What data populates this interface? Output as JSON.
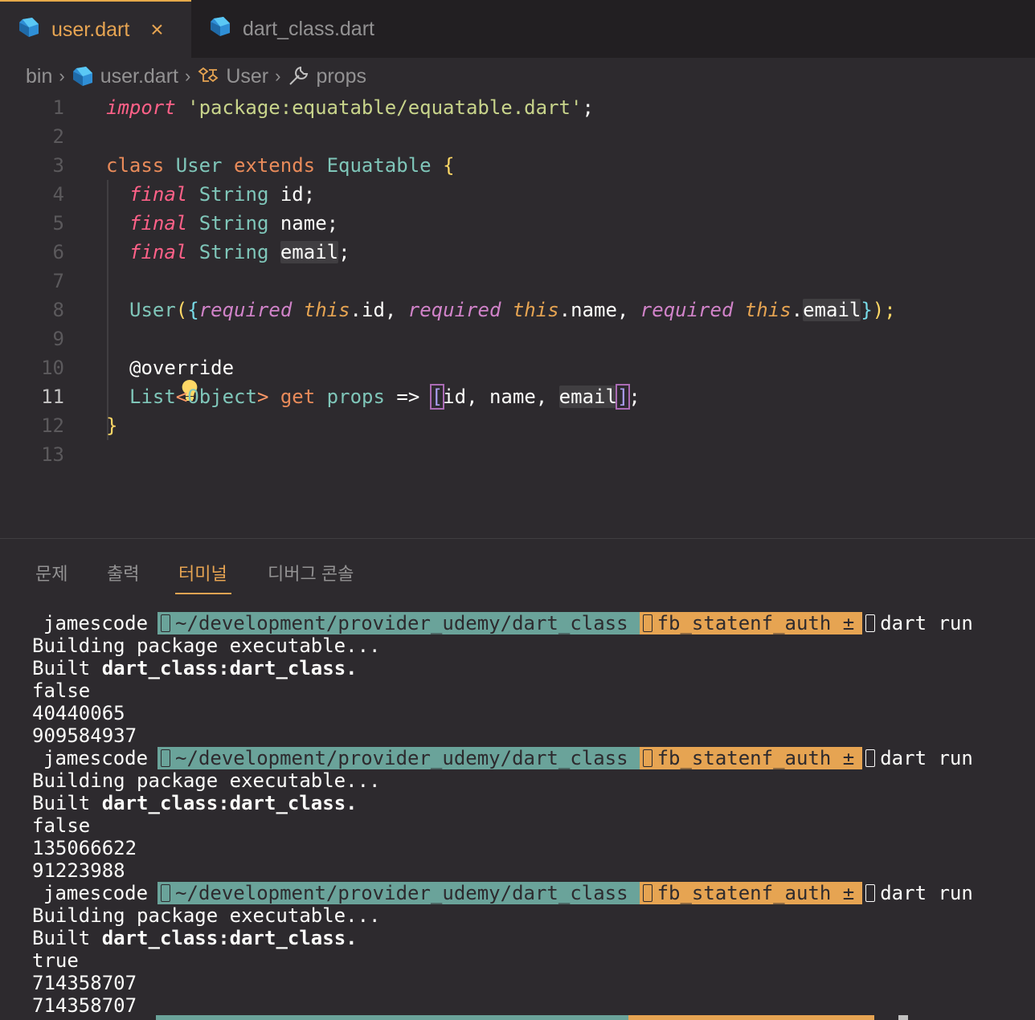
{
  "tabs": [
    {
      "label": "user.dart",
      "active": true,
      "close": "×"
    },
    {
      "label": "dart_class.dart",
      "active": false
    }
  ],
  "breadcrumb": {
    "items": [
      "bin",
      "user.dart",
      "User",
      "props"
    ]
  },
  "editor": {
    "line_numbers": [
      "1",
      "2",
      "3",
      "4",
      "5",
      "6",
      "7",
      "8",
      "9",
      "10",
      "11",
      "12",
      "13"
    ],
    "active_line": "11",
    "tokens": {
      "l1": [
        "import",
        " ",
        "'package:equatable/equatable.dart'",
        ";"
      ],
      "l3": [
        "class",
        " ",
        "User",
        " ",
        "extends",
        " ",
        "Equatable",
        " ",
        "{"
      ],
      "l4": [
        "final",
        " ",
        "String",
        " ",
        "id;"
      ],
      "l5": [
        "final",
        " ",
        "String",
        " ",
        "name;"
      ],
      "l6": [
        "final",
        " ",
        "String",
        " ",
        "email",
        ";"
      ],
      "l8": [
        "User",
        "(",
        "{",
        "required",
        " ",
        "this",
        ".id, ",
        "required",
        " ",
        "this",
        ".name, ",
        "required",
        " ",
        "this",
        ".",
        "email",
        "}",
        ");"
      ],
      "l10": [
        "@override"
      ],
      "l11": [
        "List",
        "<",
        "Object",
        ">",
        " ",
        "get",
        " ",
        "props",
        " => ",
        "[",
        "id, name, ",
        "email",
        "]",
        ";"
      ],
      "l12": [
        "}"
      ]
    }
  },
  "panel": {
    "tabs": [
      "문제",
      "출력",
      "터미널",
      "디버그 콘솔"
    ],
    "active_tab": "터미널"
  },
  "terminal": {
    "prompt": {
      "user": "jamescode",
      "path": "~/development/provider_udemy/dart_class",
      "branch": "fb_statenf_auth ±",
      "command": "dart run"
    },
    "runs": [
      {
        "building": "Building package executable...",
        "built_prefix": "Built ",
        "built_target": "dart_class:dart_class.",
        "result": "false",
        "hash1": "40440065",
        "hash2": "909584937"
      },
      {
        "building": "Building package executable...",
        "built_prefix": "Built ",
        "built_target": "dart_class:dart_class.",
        "result": "false",
        "hash1": "135066622",
        "hash2": "91223988"
      },
      {
        "building": "Building package executable...",
        "built_prefix": "Built ",
        "built_target": "dart_class:dart_class.",
        "result": "true",
        "hash1": "714358707",
        "hash2": "714358707"
      }
    ]
  },
  "colors": {
    "accent": "#e6a452",
    "path_segment": "#6aa39a",
    "background": "#2d2a2e"
  }
}
